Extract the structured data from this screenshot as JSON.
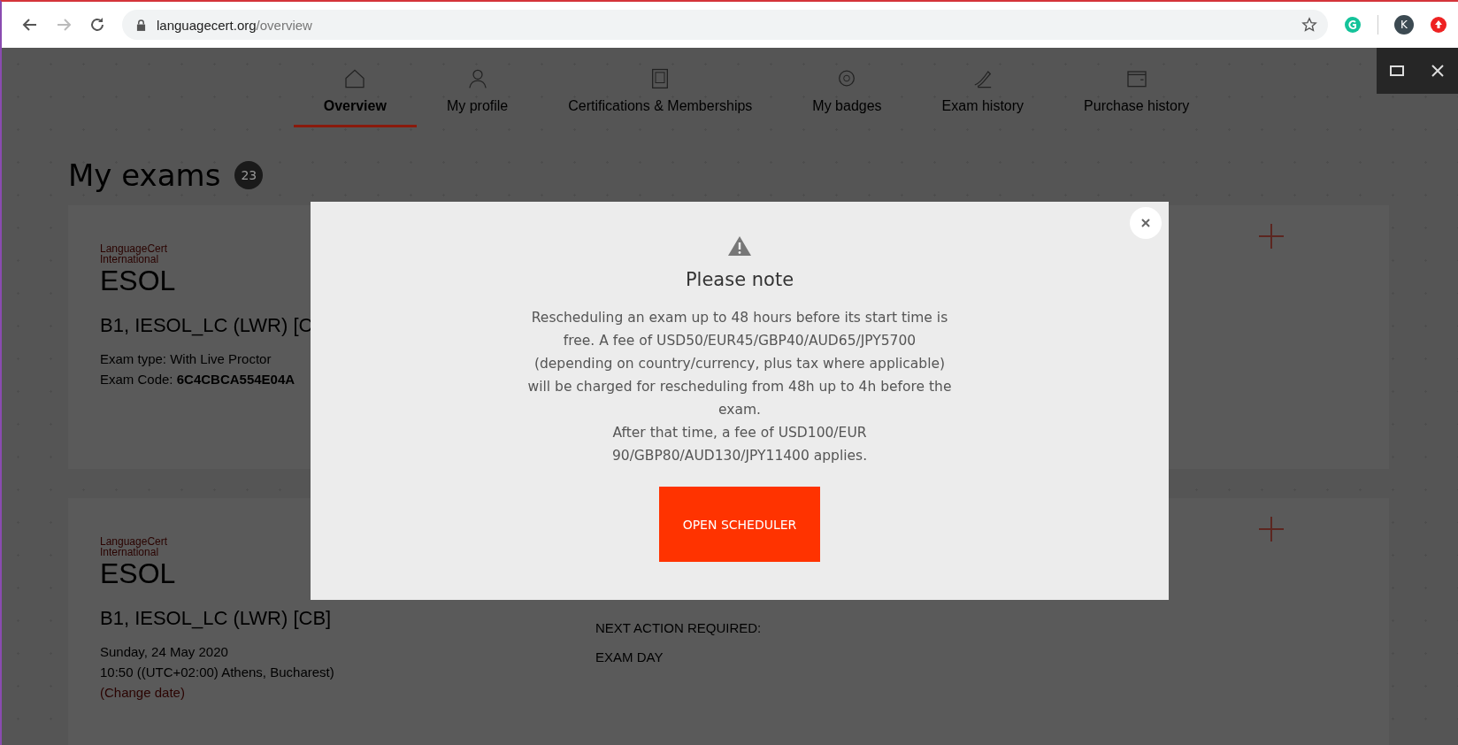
{
  "browser": {
    "url": {
      "host": "languagecert.org",
      "path": "/overview"
    },
    "profile_initial": "K"
  },
  "tabs": [
    {
      "label": "Overview",
      "selected": true
    },
    {
      "label": "My profile",
      "selected": false
    },
    {
      "label": "Certifications & Memberships",
      "selected": false
    },
    {
      "label": "My badges",
      "selected": false
    },
    {
      "label": "Exam history",
      "selected": false
    },
    {
      "label": "Purchase history",
      "selected": false
    }
  ],
  "exams": {
    "title": "My exams",
    "count": "23",
    "cards": [
      {
        "logo": {
          "line_1": "LanguageCert",
          "line_2": "International",
          "mark": "ESOL"
        },
        "title": "B1, IESOL_LC (LWR) [C",
        "details": [
          "Exam type: With Live Proctor",
          "Exam Code: **6C4CBCA554E04A**"
        ]
      },
      {
        "logo": {
          "line_1": "LanguageCert",
          "line_2": "International",
          "mark": "ESOL"
        },
        "title": "B1, IESOL_LC (LWR) [CB]",
        "details": [
          "Sunday, 24 May 2020",
          "10:50 ((UTC+02:00) Athens, Bucharest)"
        ],
        "change_link": "(Change date)",
        "next_action": {
          "label": "NEXT ACTION REQUIRED:",
          "value": "EXAM DAY"
        }
      }
    ]
  },
  "modal": {
    "title": "Please note",
    "paragraphs": [
      "Rescheduling an exam up to 48 hours before its start time is free. A fee of USD50/EUR45/GBP40/AUD65/JPY5700 (depending on country/currency, plus tax where applicable) will be charged for rescheduling from 48h up to 4h before the exam.",
      "After that time, a fee of USD100/EUR 90/GBP80/AUD130/JPY11400 applies."
    ],
    "button": "OPEN SCHEDULER"
  }
}
